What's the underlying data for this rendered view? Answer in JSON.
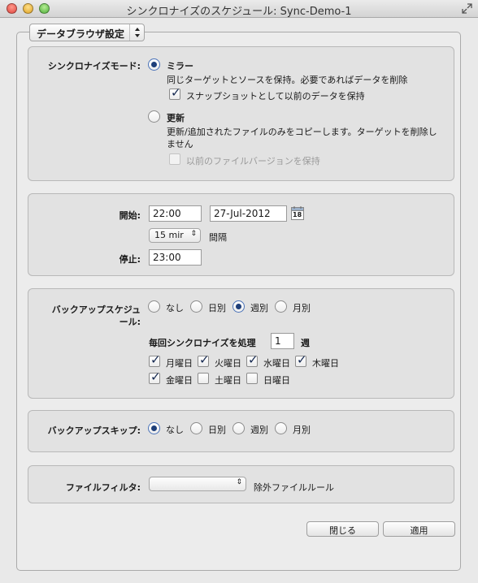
{
  "window": {
    "title": "シンクロナイズのスケジュール: Sync-Demo-1"
  },
  "popup": {
    "value": "データブラウザ設定"
  },
  "sync_mode": {
    "label": "シンクロナイズモード:",
    "mirror": {
      "label": "ミラー",
      "selected": true,
      "description": "同じターゲットとソースを保持。必要であればデータを削除",
      "keep_checkbox": {
        "label": "スナップショットとして以前のデータを保持",
        "checked": true
      }
    },
    "update": {
      "label": "更新",
      "selected": false,
      "description_line1": "更新/追加されたファイルのみをコピーします。ターゲットを削除し",
      "description_line2": "ません",
      "keep_checkbox": {
        "label": "以前のファイルバージョンを保持",
        "checked": false,
        "disabled": true
      }
    }
  },
  "timing": {
    "start_label": "開始:",
    "start_time": "22:00",
    "start_date": "27-Jul-2012",
    "interval_value": "15 mir",
    "interval_label": "間隔",
    "stop_label": "停止:",
    "stop_time": "23:00",
    "calendar_day": "18"
  },
  "backup_schedule": {
    "label_line1": "バックアップスケジュ",
    "label_line2": "ール:",
    "options": [
      {
        "label": "なし",
        "selected": false
      },
      {
        "label": "日別",
        "selected": false
      },
      {
        "label": "週別",
        "selected": true
      },
      {
        "label": "月別",
        "selected": false
      }
    ],
    "every_label": "毎回シンクロナイズを処理",
    "every_value": "1",
    "every_unit": "週",
    "days": [
      {
        "label": "月曜日",
        "checked": true
      },
      {
        "label": "火曜日",
        "checked": true
      },
      {
        "label": "水曜日",
        "checked": true
      },
      {
        "label": "木曜日",
        "checked": true
      },
      {
        "label": "金曜日",
        "checked": true
      },
      {
        "label": "土曜日",
        "checked": false
      },
      {
        "label": "日曜日",
        "checked": false
      }
    ]
  },
  "backup_skip": {
    "label": "バックアップスキップ:",
    "options": [
      {
        "label": "なし",
        "selected": true
      },
      {
        "label": "日別",
        "selected": false
      },
      {
        "label": "週別",
        "selected": false
      },
      {
        "label": "月別",
        "selected": false
      }
    ]
  },
  "file_filter": {
    "label": "ファイルフィルタ:",
    "value": "",
    "rule_label": "除外ファイルルール"
  },
  "buttons": {
    "close": "閉じる",
    "apply": "適用"
  }
}
